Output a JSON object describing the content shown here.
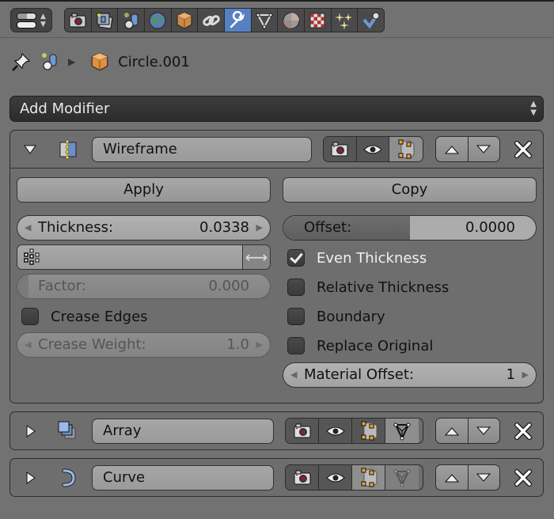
{
  "header": {
    "editor_type_icon": "properties-editor-icon",
    "context_tabs": [
      {
        "name": "render",
        "icon": "camera-icon",
        "active": false
      },
      {
        "name": "render-layers",
        "icon": "render-layers-icon",
        "active": false
      },
      {
        "name": "scene",
        "icon": "scene-icon",
        "active": false
      },
      {
        "name": "world",
        "icon": "world-icon",
        "active": false
      },
      {
        "name": "object",
        "icon": "object-cube-icon",
        "active": false
      },
      {
        "name": "constraints",
        "icon": "constraint-link-icon",
        "active": false
      },
      {
        "name": "modifiers",
        "icon": "wrench-icon",
        "active": true
      },
      {
        "name": "data",
        "icon": "mesh-data-icon",
        "active": false
      },
      {
        "name": "material",
        "icon": "material-sphere-icon",
        "active": false
      },
      {
        "name": "texture",
        "icon": "texture-checker-icon",
        "active": false
      },
      {
        "name": "particles",
        "icon": "particles-icon",
        "active": false
      },
      {
        "name": "physics",
        "icon": "physics-icon",
        "active": false
      }
    ],
    "active_color": "#5680c2"
  },
  "breadcrumb": {
    "pin_icon": "pin-icon",
    "scene_icon": "scene-icon",
    "object_name": "Circle.001"
  },
  "add_modifier": {
    "label": "Add Modifier"
  },
  "modifiers": [
    {
      "name": "Wireframe",
      "expanded": true,
      "icon": "wireframe-modifier-icon",
      "buttons": {
        "apply": "Apply",
        "copy": "Copy"
      },
      "thickness": {
        "label": "Thickness:",
        "value": "0.0338"
      },
      "offset": {
        "label": "Offset:",
        "value": "0.0000",
        "fill_fraction": 0.5
      },
      "vertex_group": {
        "value": ""
      },
      "factor": {
        "label": "Factor:",
        "value": "0.000"
      },
      "crease_edges": {
        "label": "Crease Edges",
        "checked": false
      },
      "crease_weight": {
        "label": "Crease Weight:",
        "value": "1.0"
      },
      "even_thickness": {
        "label": "Even Thickness",
        "checked": true
      },
      "relative_thickness": {
        "label": "Relative Thickness",
        "checked": false
      },
      "boundary": {
        "label": "Boundary",
        "checked": false
      },
      "replace_original": {
        "label": "Replace Original",
        "checked": false
      },
      "material_offset": {
        "label": "Material Offset:",
        "value": "1"
      }
    },
    {
      "name": "Array",
      "expanded": false,
      "icon": "array-modifier-icon"
    },
    {
      "name": "Curve",
      "expanded": false,
      "icon": "curve-modifier-icon"
    }
  ]
}
